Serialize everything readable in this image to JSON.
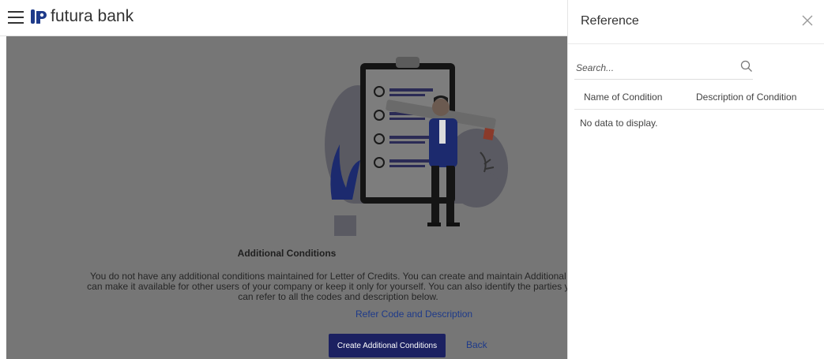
{
  "header": {
    "brand_name": "futura bank",
    "menu_icon": "hamburger-menu-icon",
    "logo_icon": "futura-bank-logo-icon"
  },
  "main": {
    "title": "Additional Conditions",
    "description_line1": "You do not have any additional conditions maintained for Letter of Credits. You can create and maintain Additional Con",
    "description_line2": "can make it available for other users of your company or keep it only for yourself. You can also identify the parties you w",
    "description_line3": "can refer to all the codes and description below.",
    "link_label": "Refer Code and Description",
    "create_button_label": "Create Additional Conditions",
    "back_label": "Back",
    "colors": {
      "overlay": "#767676",
      "primary_button": "#1c2161",
      "link": "#1e3a8a"
    }
  },
  "panel": {
    "title": "Reference",
    "close_icon": "close-icon",
    "search_placeholder": "Search...",
    "search_icon": "search-icon",
    "columns": [
      "Name of Condition",
      "Description of Condition"
    ],
    "empty_message": "No data to display."
  }
}
